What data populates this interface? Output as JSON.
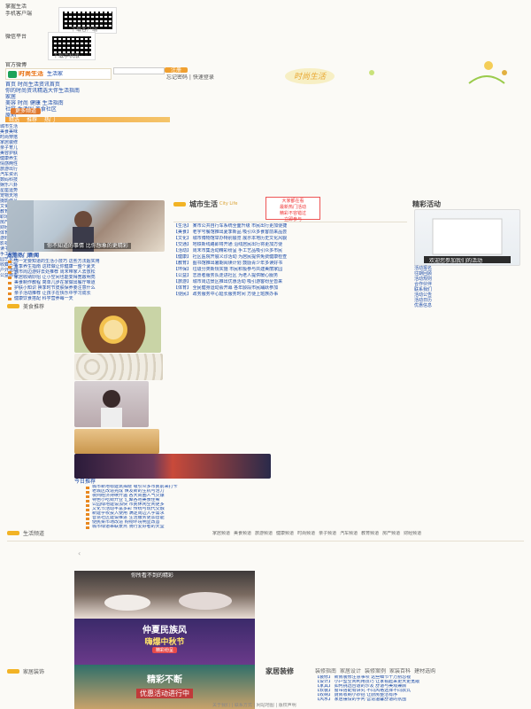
{
  "qr_top": {
    "label1": "掌握生活",
    "label2": "手机客户端",
    "caption": "下载客户端"
  },
  "qr_mid": {
    "label": "微信平台",
    "caption": "下载手机版"
  },
  "official_weibo": "官方微博",
  "brand": {
    "logo_text": "时尚生活",
    "slogan": "生活家",
    "sub": "登录 | 注册"
  },
  "login": {
    "user_placeholder": "",
    "register": "注册",
    "links": "忘记密码 | 快速登录"
  },
  "left_menu": {
    "items": [
      "首页 时尚生活资讯首页",
      "你的时尚资讯精选大伴生活指南",
      "家居",
      "美容 时尚 健康 生活指南",
      "社区 生活圈 美食社区",
      "原创"
    ],
    "btn": "更多频道"
  },
  "orange_tabs": [
    "精选",
    "推荐",
    "热门"
  ],
  "left_column_links": [
    "城市生活",
    "美食美味",
    "时尚穿搭",
    "家居装修",
    "亲子育儿",
    "美容护肤",
    "健康养生",
    "情感两性",
    "旅游出行",
    "汽车资讯",
    "数码科技",
    "娱乐八卦",
    "星座运势",
    "宠物天地",
    "摄影作品",
    "文化艺术",
    "教育学习",
    "职场生涯",
    "房产楼市",
    "财经理财",
    "体育运动",
    "游戏动漫",
    "影视音乐",
    "读书笔记",
    "手工DIY",
    "园艺花卉",
    "收藏古玩",
    "户外运动",
    "公益慈善"
  ],
  "feature_photo_caption": "你不知道的事情 比你想象的更精彩",
  "hot_head": "本周热门新闻",
  "hot_list": [
    "你一定要知道的生活小技巧 这些方法超实用",
    "夏季养生指南 这样做让你健康一整个夏天",
    "城市周边游好去处推荐 周末带家人去放松",
    "家居收纳妙招 让小空间也能变得宽敞明亮",
    "美食制作教程 简单几步在家做出餐厅味道",
    "护肤小知识 换季时节皮肤保养要注意什么",
    "亲子活动推荐 让孩子在快乐中学习成长",
    "健康饮食搭配 科学营养每一天"
  ],
  "city_life": {
    "title": "城市生活",
    "sub": "City Life",
    "badge_lines": [
      "大家都在看",
      "最新热门活动",
      "精彩不容错过",
      "立即参与"
    ]
  },
  "city_items": [
    "【生活】 某市公共自行车系统全面升级 市民出行更加便捷",
    "【美食】 老字号餐馆推出夏季新品 吸引众多食客前来品尝",
    "【文化】 城市博物馆举办特别展览 展示本地历史文化风貌",
    "【交通】 地铁新线路即将开通 沿线居民出行将更加方便",
    "【活动】 周末市集活动精彩纷呈 手工艺品吸引众多市民",
    "【健康】 社区医院开展义诊活动 为居民提供免费健康检查",
    "【教育】 图书馆推出暑期阅读计划 鼓励青少年多读好书",
    "【环保】 垃圾分类新规实施 市民积极参与共建美丽家园",
    "【公益】 志愿者服务队走进社区 为老人提供暖心服务",
    "【旅游】 城市周边景区推出优惠活动 吸引游客纷至沓来",
    "【体育】 全民健身运动会开幕 各年龄段市民踊跃参加",
    "【便民】 政务服务中心延长服务时间 方便上班族办事"
  ],
  "events": {
    "title": "精彩活动",
    "photo_caption": "欢迎您参加我们的活动",
    "links": [
      "活动报名",
      "往期回顾",
      "活动规则",
      "合作伙伴",
      "联系我们",
      "活动公告",
      "活动日历",
      "优惠信息"
    ]
  },
  "food_section": {
    "title": "美食推荐"
  },
  "recommend_list": [
    "城市新地标建筑揭晓 吸引众多市民前来打卡",
    "老城区改造完成 焕发新的生机与活力",
    "夜间经济持续升温 各大商圈人气火爆",
    "特色小吃街开业 汇聚各地美食佳肴",
    "公园绿地建设加快 市民休闲空间更多",
    "文化节活动丰富多彩 传统与现代交融",
    "新建学校投入使用 满足周边入学需求",
    "智慧社区建设推进 生活服务更加智能",
    "便民菜市场改造 购物环境明显改善",
    "城市绿道串联景点 骑行爱好者的天堂"
  ],
  "recommend_head": "今日推荐",
  "bottom_nav": {
    "title": "生活频道",
    "links": [
      "家居频道",
      "美食频道",
      "旅游频道",
      "健康频道",
      "时尚频道",
      "亲子频道",
      "汽车频道",
      "教育频道",
      "房产频道",
      "财经频道"
    ]
  },
  "ad_banner": {
    "top_label": "你所看不到的精彩",
    "mid_title": "仲夏民族风",
    "mid_sub": "嗨爆中秋节",
    "mid_tag": "精彩纷呈",
    "bottom_title": "精彩不断",
    "bottom_sub": "优惠活动进行中"
  },
  "home_section": {
    "title": "家居装修",
    "left_title": "家居装饰",
    "tags": [
      "装修指南",
      "家居设计",
      "装修案例",
      "家装百科",
      "建材选购"
    ]
  },
  "home_list": [
    "【装修】 新房装修注意事项 这些细节千万别忽视",
    "【设计】 小户型空间利用技巧 让家看起来更大更宽敞",
    "【家具】 如何挑选合适的沙发 舒适与美观兼顾",
    "【软装】 窗帘搭配有讲究 不同风格选择不同款式",
    "【收纳】 厨房收纳小妙招 让厨房整洁有序",
    "【风水】 家居摆设的学问 营造温馨舒适的氛围"
  ],
  "footer": {
    "text": "关于我们 | 联系方式 | 网站地图 | 版权声明"
  }
}
